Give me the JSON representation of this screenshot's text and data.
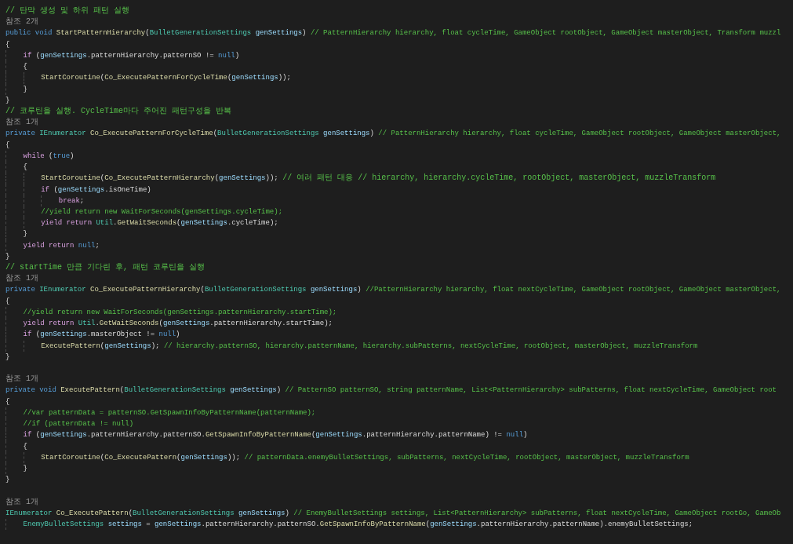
{
  "editor": {
    "lines": [
      {
        "kind": "code",
        "tokens": [
          {
            "kind": "comment",
            "text": "// 탄막 생성 및 하위 패턴 실행"
          }
        ]
      },
      {
        "kind": "codelens",
        "text": "참조 2개"
      },
      {
        "kind": "code",
        "tokens": [
          {
            "kind": "kw",
            "text": "public void "
          },
          {
            "kind": "fn",
            "text": "StartPatternHierarchy"
          },
          {
            "kind": "plain",
            "text": "("
          },
          {
            "kind": "type",
            "text": "BulletGenerationSettings "
          },
          {
            "kind": "param",
            "text": "genSettings"
          },
          {
            "kind": "plain",
            "text": ") "
          },
          {
            "kind": "comment",
            "text": "// PatternHierarchy hierarchy, float cycleTime, GameObject rootObject, GameObject masterObject, Transform muzzl"
          }
        ]
      },
      {
        "kind": "code",
        "tokens": [
          {
            "kind": "plain",
            "text": "{"
          }
        ]
      },
      {
        "kind": "code",
        "tokens": [
          {
            "kind": "ctrl",
            "text": "    if"
          },
          {
            "kind": "plain",
            "text": " ("
          },
          {
            "kind": "param",
            "text": "genSettings"
          },
          {
            "kind": "plain",
            "text": "."
          },
          {
            "kind": "prop",
            "text": "patternHierarchy"
          },
          {
            "kind": "plain",
            "text": "."
          },
          {
            "kind": "prop",
            "text": "patternSO"
          },
          {
            "kind": "plain",
            "text": " != "
          },
          {
            "kind": "kw",
            "text": "null"
          },
          {
            "kind": "plain",
            "text": ")"
          }
        ]
      },
      {
        "kind": "code",
        "tokens": [
          {
            "kind": "plain",
            "text": "    {"
          }
        ]
      },
      {
        "kind": "code",
        "tokens": [
          {
            "kind": "fn",
            "text": "        StartCoroutine"
          },
          {
            "kind": "plain",
            "text": "("
          },
          {
            "kind": "fn",
            "text": "Co_ExecutePatternForCycleTime"
          },
          {
            "kind": "plain",
            "text": "("
          },
          {
            "kind": "param",
            "text": "genSettings"
          },
          {
            "kind": "plain",
            "text": "));"
          }
        ]
      },
      {
        "kind": "code",
        "tokens": [
          {
            "kind": "plain",
            "text": "    }"
          }
        ]
      },
      {
        "kind": "code",
        "tokens": [
          {
            "kind": "plain",
            "text": "}"
          }
        ]
      },
      {
        "kind": "code",
        "tokens": [
          {
            "kind": "comment",
            "text": "// 코루틴을 실행. CycleTime마다 주어진 패턴구성을 반복"
          }
        ]
      },
      {
        "kind": "codelens",
        "text": "참조 1개"
      },
      {
        "kind": "code",
        "tokens": [
          {
            "kind": "kw",
            "text": "private "
          },
          {
            "kind": "type",
            "text": "IEnumerator "
          },
          {
            "kind": "fn",
            "text": "Co_ExecutePatternForCycleTime"
          },
          {
            "kind": "plain",
            "text": "("
          },
          {
            "kind": "type",
            "text": "BulletGenerationSettings "
          },
          {
            "kind": "param",
            "text": "genSettings"
          },
          {
            "kind": "plain",
            "text": ") "
          },
          {
            "kind": "comment",
            "text": "// PatternHierarchy hierarchy, float cycleTime, GameObject rootObject, GameObject masterObject,"
          }
        ]
      },
      {
        "kind": "code",
        "tokens": [
          {
            "kind": "plain",
            "text": "{"
          }
        ]
      },
      {
        "kind": "code",
        "tokens": [
          {
            "kind": "ctrl",
            "text": "    while"
          },
          {
            "kind": "plain",
            "text": " ("
          },
          {
            "kind": "kw",
            "text": "true"
          },
          {
            "kind": "plain",
            "text": ")"
          }
        ]
      },
      {
        "kind": "code",
        "tokens": [
          {
            "kind": "plain",
            "text": "    {"
          }
        ]
      },
      {
        "kind": "code",
        "tokens": [
          {
            "kind": "fn",
            "text": "        StartCoroutine"
          },
          {
            "kind": "plain",
            "text": "("
          },
          {
            "kind": "fn",
            "text": "Co_ExecutePatternHierarchy"
          },
          {
            "kind": "plain",
            "text": "("
          },
          {
            "kind": "param",
            "text": "genSettings"
          },
          {
            "kind": "plain",
            "text": ")); "
          },
          {
            "kind": "comment",
            "text": "// 여러 패턴 대응 // hierarchy, hierarchy.cycleTime, rootObject, masterObject, muzzleTransform"
          }
        ]
      },
      {
        "kind": "code",
        "tokens": [
          {
            "kind": "ctrl",
            "text": "        if"
          },
          {
            "kind": "plain",
            "text": " ("
          },
          {
            "kind": "param",
            "text": "genSettings"
          },
          {
            "kind": "plain",
            "text": "."
          },
          {
            "kind": "prop",
            "text": "isOneTime"
          },
          {
            "kind": "plain",
            "text": ")"
          }
        ]
      },
      {
        "kind": "code",
        "tokens": [
          {
            "kind": "ctrl",
            "text": "            break"
          },
          {
            "kind": "plain",
            "text": ";"
          }
        ]
      },
      {
        "kind": "code",
        "tokens": [
          {
            "kind": "comment",
            "text": "        //yield return new WaitForSeconds(genSettings.cycleTime);"
          }
        ]
      },
      {
        "kind": "code",
        "tokens": [
          {
            "kind": "ctrl",
            "text": "        yield return "
          },
          {
            "kind": "type",
            "text": "Util"
          },
          {
            "kind": "plain",
            "text": "."
          },
          {
            "kind": "fn",
            "text": "GetWaitSeconds"
          },
          {
            "kind": "plain",
            "text": "("
          },
          {
            "kind": "param",
            "text": "genSettings"
          },
          {
            "kind": "plain",
            "text": "."
          },
          {
            "kind": "prop",
            "text": "cycleTime"
          },
          {
            "kind": "plain",
            "text": ");"
          }
        ]
      },
      {
        "kind": "code",
        "tokens": [
          {
            "kind": "plain",
            "text": "    }"
          }
        ]
      },
      {
        "kind": "code",
        "tokens": [
          {
            "kind": "ctrl",
            "text": "    yield return "
          },
          {
            "kind": "kw",
            "text": "null"
          },
          {
            "kind": "plain",
            "text": ";"
          }
        ]
      },
      {
        "kind": "code",
        "tokens": [
          {
            "kind": "plain",
            "text": "}"
          }
        ]
      },
      {
        "kind": "code",
        "tokens": [
          {
            "kind": "comment",
            "text": "// startTime 만큼 기다린 후, 패턴 코루틴을 실행"
          }
        ]
      },
      {
        "kind": "codelens",
        "text": "참조 1개"
      },
      {
        "kind": "code",
        "tokens": [
          {
            "kind": "kw",
            "text": "private "
          },
          {
            "kind": "type",
            "text": "IEnumerator "
          },
          {
            "kind": "fn",
            "text": "Co_ExecutePatternHierarchy"
          },
          {
            "kind": "plain",
            "text": "("
          },
          {
            "kind": "type",
            "text": "BulletGenerationSettings "
          },
          {
            "kind": "param",
            "text": "genSettings"
          },
          {
            "kind": "plain",
            "text": ") "
          },
          {
            "kind": "comment",
            "text": "//PatternHierarchy hierarchy, float nextCycleTime, GameObject rootObject, GameObject masterObject,"
          }
        ]
      },
      {
        "kind": "code",
        "tokens": [
          {
            "kind": "plain",
            "text": "{"
          }
        ]
      },
      {
        "kind": "code",
        "tokens": [
          {
            "kind": "comment",
            "text": "    //yield return new WaitForSeconds(genSettings.patternHierarchy.startTime);"
          }
        ]
      },
      {
        "kind": "code",
        "tokens": [
          {
            "kind": "ctrl",
            "text": "    yield return "
          },
          {
            "kind": "type",
            "text": "Util"
          },
          {
            "kind": "plain",
            "text": "."
          },
          {
            "kind": "fn",
            "text": "GetWaitSeconds"
          },
          {
            "kind": "plain",
            "text": "("
          },
          {
            "kind": "param",
            "text": "genSettings"
          },
          {
            "kind": "plain",
            "text": "."
          },
          {
            "kind": "prop",
            "text": "patternHierarchy"
          },
          {
            "kind": "plain",
            "text": "."
          },
          {
            "kind": "prop",
            "text": "startTime"
          },
          {
            "kind": "plain",
            "text": ");"
          }
        ]
      },
      {
        "kind": "code",
        "tokens": [
          {
            "kind": "ctrl",
            "text": "    if"
          },
          {
            "kind": "plain",
            "text": " ("
          },
          {
            "kind": "param",
            "text": "genSettings"
          },
          {
            "kind": "plain",
            "text": "."
          },
          {
            "kind": "prop",
            "text": "masterObject"
          },
          {
            "kind": "plain",
            "text": " != "
          },
          {
            "kind": "kw",
            "text": "null"
          },
          {
            "kind": "plain",
            "text": ")"
          }
        ]
      },
      {
        "kind": "code",
        "tokens": [
          {
            "kind": "fn",
            "text": "        ExecutePattern"
          },
          {
            "kind": "plain",
            "text": "("
          },
          {
            "kind": "param",
            "text": "genSettings"
          },
          {
            "kind": "plain",
            "text": "); "
          },
          {
            "kind": "comment",
            "text": "// hierarchy.patternSO, hierarchy.patternName, hierarchy.subPatterns, nextCycleTime, rootObject, masterObject, muzzleTransform"
          }
        ]
      },
      {
        "kind": "code",
        "tokens": [
          {
            "kind": "plain",
            "text": "}"
          }
        ]
      },
      {
        "kind": "blank"
      },
      {
        "kind": "codelens",
        "text": "참조 1개"
      },
      {
        "kind": "code",
        "tokens": [
          {
            "kind": "kw",
            "text": "private void "
          },
          {
            "kind": "fn",
            "text": "ExecutePattern"
          },
          {
            "kind": "plain",
            "text": "("
          },
          {
            "kind": "type",
            "text": "BulletGenerationSettings "
          },
          {
            "kind": "param",
            "text": "genSettings"
          },
          {
            "kind": "plain",
            "text": ") "
          },
          {
            "kind": "comment",
            "text": "// PatternSO patternSO, string patternName, List<PatternHierarchy> subPatterns, float nextCycleTime, GameObject root"
          }
        ]
      },
      {
        "kind": "code",
        "tokens": [
          {
            "kind": "plain",
            "text": "{"
          }
        ]
      },
      {
        "kind": "code",
        "tokens": [
          {
            "kind": "comment",
            "text": "    //var patternData = patternSO.GetSpawnInfoByPatternName(patternName);"
          }
        ]
      },
      {
        "kind": "code",
        "tokens": [
          {
            "kind": "comment",
            "text": "    //if (patternData != null)"
          }
        ]
      },
      {
        "kind": "code",
        "tokens": [
          {
            "kind": "ctrl",
            "text": "    if"
          },
          {
            "kind": "plain",
            "text": " ("
          },
          {
            "kind": "param",
            "text": "genSettings"
          },
          {
            "kind": "plain",
            "text": "."
          },
          {
            "kind": "prop",
            "text": "patternHierarchy"
          },
          {
            "kind": "plain",
            "text": "."
          },
          {
            "kind": "prop",
            "text": "patternSO"
          },
          {
            "kind": "plain",
            "text": "."
          },
          {
            "kind": "fn",
            "text": "GetSpawnInfoByPatternName"
          },
          {
            "kind": "plain",
            "text": "("
          },
          {
            "kind": "param",
            "text": "genSettings"
          },
          {
            "kind": "plain",
            "text": "."
          },
          {
            "kind": "prop",
            "text": "patternHierarchy"
          },
          {
            "kind": "plain",
            "text": "."
          },
          {
            "kind": "prop",
            "text": "patternName"
          },
          {
            "kind": "plain",
            "text": ") != "
          },
          {
            "kind": "kw",
            "text": "null"
          },
          {
            "kind": "plain",
            "text": ")"
          }
        ]
      },
      {
        "kind": "code",
        "tokens": [
          {
            "kind": "plain",
            "text": "    {"
          }
        ]
      },
      {
        "kind": "code",
        "tokens": [
          {
            "kind": "fn",
            "text": "        StartCoroutine"
          },
          {
            "kind": "plain",
            "text": "("
          },
          {
            "kind": "fn",
            "text": "Co_ExecutePattern"
          },
          {
            "kind": "plain",
            "text": "("
          },
          {
            "kind": "param",
            "text": "genSettings"
          },
          {
            "kind": "plain",
            "text": ")); "
          },
          {
            "kind": "comment",
            "text": "// patternData.enemyBulletSettings, subPatterns, nextCycleTime, rootObject, masterObject, muzzleTransform"
          }
        ]
      },
      {
        "kind": "code",
        "tokens": [
          {
            "kind": "plain",
            "text": "    }"
          }
        ]
      },
      {
        "kind": "code",
        "tokens": [
          {
            "kind": "plain",
            "text": "}"
          }
        ]
      },
      {
        "kind": "blank"
      },
      {
        "kind": "codelens",
        "text": "참조 1개"
      },
      {
        "kind": "code",
        "tokens": [
          {
            "kind": "type",
            "text": "IEnumerator "
          },
          {
            "kind": "fn",
            "text": "Co_ExecutePattern"
          },
          {
            "kind": "plain",
            "text": "("
          },
          {
            "kind": "type",
            "text": "BulletGenerationSettings "
          },
          {
            "kind": "param",
            "text": "genSettings"
          },
          {
            "kind": "plain",
            "text": ") "
          },
          {
            "kind": "comment",
            "text": "// EnemyBulletSettings settings, List<PatternHierarchy> subPatterns, float nextCycleTime, GameObject rootGo, GameOb"
          }
        ]
      },
      {
        "kind": "code",
        "tokens": [
          {
            "kind": "type",
            "text": "    EnemyBulletSettings "
          },
          {
            "kind": "param",
            "text": "settings"
          },
          {
            "kind": "plain",
            "text": " = "
          },
          {
            "kind": "param",
            "text": "genSettings"
          },
          {
            "kind": "plain",
            "text": "."
          },
          {
            "kind": "prop",
            "text": "patternHierarchy"
          },
          {
            "kind": "plain",
            "text": "."
          },
          {
            "kind": "prop",
            "text": "patternSO"
          },
          {
            "kind": "plain",
            "text": "."
          },
          {
            "kind": "fn",
            "text": "GetSpawnInfoByPatternName"
          },
          {
            "kind": "plain",
            "text": "("
          },
          {
            "kind": "param",
            "text": "genSettings"
          },
          {
            "kind": "plain",
            "text": "."
          },
          {
            "kind": "prop",
            "text": "patternHierarchy"
          },
          {
            "kind": "plain",
            "text": "."
          },
          {
            "kind": "prop",
            "text": "patternName"
          },
          {
            "kind": "plain",
            "text": ")."
          },
          {
            "kind": "prop",
            "text": "enemyBulletSettings"
          },
          {
            "kind": "plain",
            "text": ";"
          }
        ]
      }
    ]
  }
}
